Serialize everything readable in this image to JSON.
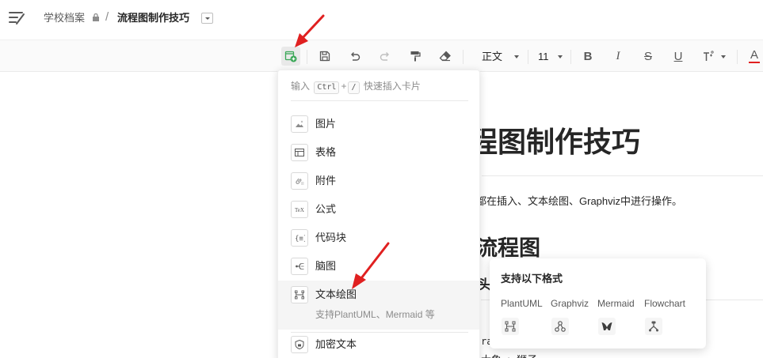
{
  "header": {
    "breadcrumb_root": "学校档案",
    "breadcrumb_separator": "/",
    "doc_title": "流程图制作技巧"
  },
  "toolbar": {
    "insert_icon": "insert-card-icon",
    "save_icon": "save-icon",
    "undo_icon": "undo-icon",
    "redo_icon": "redo-icon",
    "format_painter_icon": "format-painter-icon",
    "clear_format_icon": "eraser-icon",
    "paragraph_style": "正文",
    "font_size": "11",
    "bold_label": "B",
    "italic_label": "I",
    "strike_label": "S",
    "underline_label": "U",
    "superscript_icon": "superscript-icon",
    "font_color_label": "A",
    "font_color": "#e02020"
  },
  "insert_menu": {
    "hint_prefix": "输入",
    "hint_key1": "Ctrl",
    "hint_plus": "+",
    "hint_key2": "/",
    "hint_suffix": "快速插入卡片",
    "items": [
      {
        "label": "图片",
        "icon": "image-icon"
      },
      {
        "label": "表格",
        "icon": "table-icon"
      },
      {
        "label": "附件",
        "icon": "attachment-icon"
      },
      {
        "label": "公式",
        "icon": "formula-icon"
      },
      {
        "label": "代码块",
        "icon": "code-block-icon"
      },
      {
        "label": "脑图",
        "icon": "mindmap-icon"
      },
      {
        "label": "文本绘图",
        "icon": "text-diagram-icon",
        "sublabel": "支持PlantUML、Mermaid 等"
      },
      {
        "label": "加密文本",
        "icon": "encrypted-text-icon"
      }
    ]
  },
  "format_card": {
    "title": "支持以下格式",
    "formats": [
      {
        "label": "PlantUML",
        "icon": "plantuml-icon"
      },
      {
        "label": "Graphviz",
        "icon": "graphviz-icon"
      },
      {
        "label": "Mermaid",
        "icon": "mermaid-icon"
      },
      {
        "label": "Flowchart",
        "icon": "flowchart-icon"
      }
    ]
  },
  "document": {
    "title_partial": "程图制作技巧",
    "paragraph_partial": "都在插入、文本绘图、Graphviz中进行操作。",
    "h2_partial": "流程图",
    "h3_partial": "头",
    "code_line1_partial": "ra",
    "code_line2_partial": "大象 -> 狮子;"
  },
  "colors": {
    "accent_green": "#3aa757",
    "annotation_red": "#e02020"
  }
}
